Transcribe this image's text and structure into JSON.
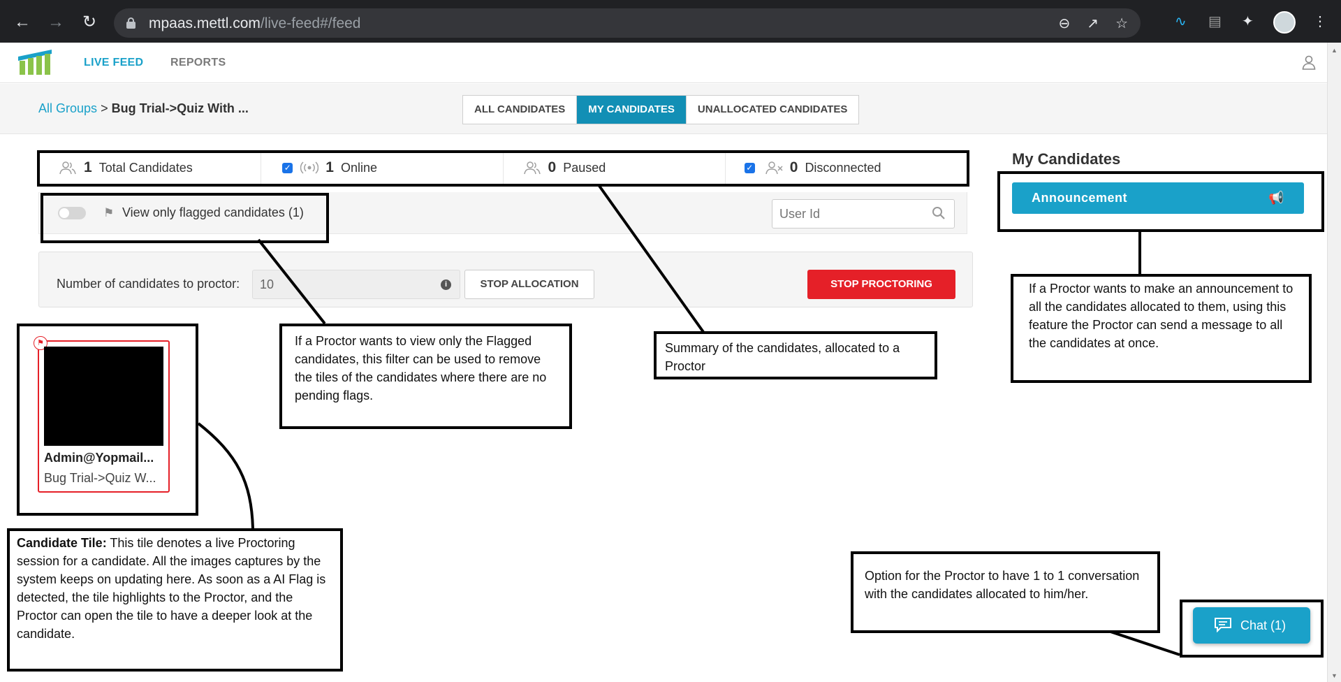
{
  "browser": {
    "url_host": "mpaas.mettl.com",
    "url_path": "/live-feed#/feed"
  },
  "header": {
    "nav": [
      "LIVE FEED",
      "REPORTS"
    ]
  },
  "breadcrumb": {
    "root": "All Groups",
    "separator": ">",
    "current": "Bug Trial->Quiz With ..."
  },
  "tabs": [
    {
      "label": "ALL CANDIDATES",
      "active": false
    },
    {
      "label": "MY CANDIDATES",
      "active": true
    },
    {
      "label": "UNALLOCATED CANDIDATES",
      "active": false
    }
  ],
  "stats": [
    {
      "count": "1",
      "label": "Total Candidates",
      "checked": false
    },
    {
      "count": "1",
      "label": "Online",
      "checked": true
    },
    {
      "count": "0",
      "label": "Paused",
      "checked": false
    },
    {
      "count": "0",
      "label": "Disconnected",
      "checked": true
    }
  ],
  "filter": {
    "flagged_label": "View only flagged candidates (1)",
    "search_placeholder": "User Id"
  },
  "allocation": {
    "label": "Number of candidates to proctor:",
    "value": "10",
    "stop_allocation": "STOP ALLOCATION",
    "stop_proctoring": "STOP PROCTORING"
  },
  "right_panel": {
    "title": "My Candidates",
    "announcement": "Announcement"
  },
  "tile": {
    "name": "Admin@Yopmail...",
    "group": "Bug Trial->Quiz W..."
  },
  "chat": {
    "label": "Chat (1)"
  },
  "annotations": {
    "flag_filter": "If a Proctor wants to view only the Flagged candidates, this filter can be used to remove the tiles of the candidates where there are no pending flags.",
    "summary": "Summary of the candidates, allocated to a Proctor",
    "announcement": "If a Proctor wants to make an announcement to all the candidates allocated to them, using this feature the Proctor can send a message to all the candidates at once.",
    "tile_heading": "Candidate Tile:",
    "tile_body": " This tile denotes a live Proctoring session for a candidate. All the images captures by the system keeps on updating here. As soon as a AI Flag is detected, the tile highlights to the Proctor, and the Proctor can open the tile to have a deeper look at the candidate.",
    "chat": "Option for the Proctor to have 1 to 1 conversation with the candidates allocated to him/her."
  },
  "colors": {
    "accent": "#1aa1c9",
    "tab_active": "#128fb5",
    "danger": "#e52028"
  }
}
